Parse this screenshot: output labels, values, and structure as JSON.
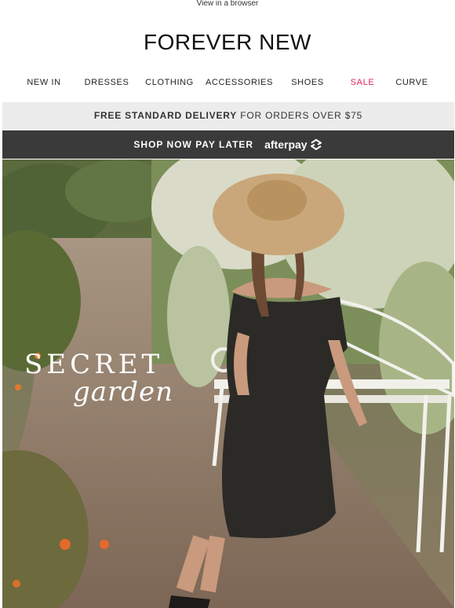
{
  "header": {
    "view_in_browser": "View in a browser",
    "logo": "FOREVER NEW"
  },
  "nav": {
    "items": [
      {
        "label": "NEW IN"
      },
      {
        "label": "DRESSES"
      },
      {
        "label": "CLOTHING"
      },
      {
        "label": "ACCESSORIES"
      },
      {
        "label": "SHOES"
      },
      {
        "label": "SALE"
      },
      {
        "label": "CURVE"
      }
    ],
    "sale_color": "#e2235a"
  },
  "delivery_banner": {
    "bold": "FREE STANDARD DELIVERY",
    "text": " FOR ORDERS OVER $75"
  },
  "afterpay_banner": {
    "text": "SHOP NOW PAY LATER",
    "brand": "afterpay",
    "brand_icon": "afterpay-arrows-icon"
  },
  "hero": {
    "title": "SECRET",
    "subtitle": "garden",
    "image": "woman-in-black-off-shoulder-dress-and-straw-hat-on-white-garden-bench"
  },
  "colors": {
    "afterpay_bar": "#3a3a3a",
    "delivery_bar": "#ececec"
  }
}
